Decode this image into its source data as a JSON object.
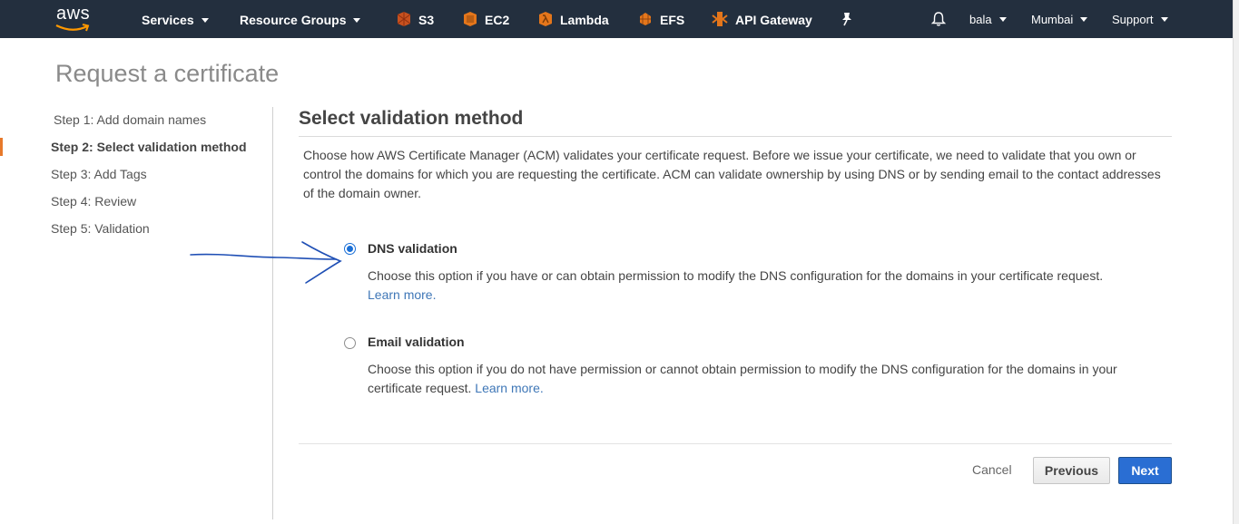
{
  "nav": {
    "logo_text": "aws",
    "services": "Services",
    "resource_groups": "Resource Groups",
    "shortcuts": [
      {
        "label": "S3",
        "icon": "s3-icon",
        "color": "#e05243"
      },
      {
        "label": "EC2",
        "icon": "ec2-icon",
        "color": "#f58536"
      },
      {
        "label": "Lambda",
        "icon": "lambda-icon",
        "color": "#f58536"
      },
      {
        "label": "EFS",
        "icon": "efs-icon",
        "color": "#f58536"
      },
      {
        "label": "API Gateway",
        "icon": "api-gateway-icon",
        "color": "#f58536"
      }
    ],
    "user": "bala",
    "region": "Mumbai",
    "support": "Support"
  },
  "page": {
    "title": "Request a certificate"
  },
  "steps": [
    {
      "label": "Step 1: Add domain names",
      "active": false
    },
    {
      "label": "Step 2: Select validation method",
      "active": true
    },
    {
      "label": "Step 3: Add Tags",
      "active": false
    },
    {
      "label": "Step 4: Review",
      "active": false
    },
    {
      "label": "Step 5: Validation",
      "active": false
    }
  ],
  "main": {
    "section_title": "Select validation method",
    "description": "Choose how AWS Certificate Manager (ACM) validates your certificate request. Before we issue your certificate, we need to validate that you own or control the domains for which you are requesting the certificate. ACM can validate ownership by using DNS or by sending email to the contact addresses of the domain owner.",
    "options": [
      {
        "title": "DNS validation",
        "description": "Choose this option if you have or can obtain permission to modify the DNS configuration for the domains in your certificate request.",
        "link": "Learn more.",
        "selected": true
      },
      {
        "title": "Email validation",
        "description": "Choose this option if you do not have permission or cannot obtain permission to modify the DNS configuration for the domains in your certificate request.",
        "link": "Learn more.",
        "selected": false
      }
    ]
  },
  "footer": {
    "cancel": "Cancel",
    "previous": "Previous",
    "next": "Next"
  },
  "colors": {
    "nav_bg": "#232f3e",
    "step_marker": "#e7792b",
    "primary_button": "#2a6ed3",
    "link": "#3f77b7",
    "annotation_ink": "#1f4fb5"
  }
}
